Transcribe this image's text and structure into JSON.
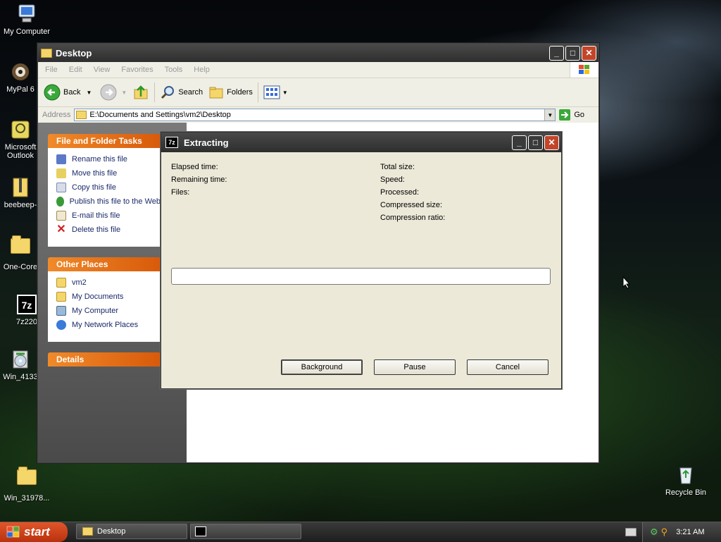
{
  "desktop_icons": [
    {
      "label": "My Computer",
      "icon": "computer-icon"
    },
    {
      "label": "MyPal 6",
      "icon": "mypal-icon"
    },
    {
      "label": "Microsoft Outlook",
      "icon": "outlook-icon"
    },
    {
      "label": "beebeep-",
      "icon": "zip-folder-icon"
    },
    {
      "label": "One-Core",
      "icon": "folder-icon"
    },
    {
      "label": "7z220",
      "icon": "7zip-icon"
    },
    {
      "label": "Win_4133",
      "icon": "cd-icon"
    },
    {
      "label": "Win_31978...",
      "icon": "folder-icon"
    },
    {
      "label": "Recycle Bin",
      "icon": "recycle-bin-icon"
    }
  ],
  "explorer": {
    "title": "Desktop",
    "menu": [
      "File",
      "Edit",
      "View",
      "Favorites",
      "Tools",
      "Help"
    ],
    "toolbar": {
      "back": "Back",
      "search": "Search",
      "folders": "Folders"
    },
    "address_label": "Address",
    "address_value": "E:\\Documents and Settings\\vm2\\Desktop",
    "go_label": "Go",
    "tasks_panel": {
      "title": "File and Folder Tasks",
      "items": [
        "Rename this file",
        "Move this file",
        "Copy this file",
        "Publish this file to the Web",
        "E-mail this file",
        "Delete this file"
      ]
    },
    "places_panel": {
      "title": "Other Places",
      "items": [
        "vm2",
        "My Documents",
        "My Computer",
        "My Network Places"
      ]
    },
    "details_panel": {
      "title": "Details"
    }
  },
  "dialog": {
    "title": "Extracting",
    "left_labels": [
      "Elapsed time:",
      "Remaining time:",
      "Files:"
    ],
    "right_labels": [
      "Total size:",
      "Speed:",
      "Processed:",
      "Compressed size:",
      "Compression ratio:"
    ],
    "progress": 0,
    "buttons": {
      "background": "Background",
      "pause": "Pause",
      "cancel": "Cancel"
    }
  },
  "taskbar": {
    "start": "start",
    "tasks": [
      {
        "label": "Desktop"
      },
      {
        "label": ""
      }
    ],
    "clock": "3:21 AM"
  }
}
